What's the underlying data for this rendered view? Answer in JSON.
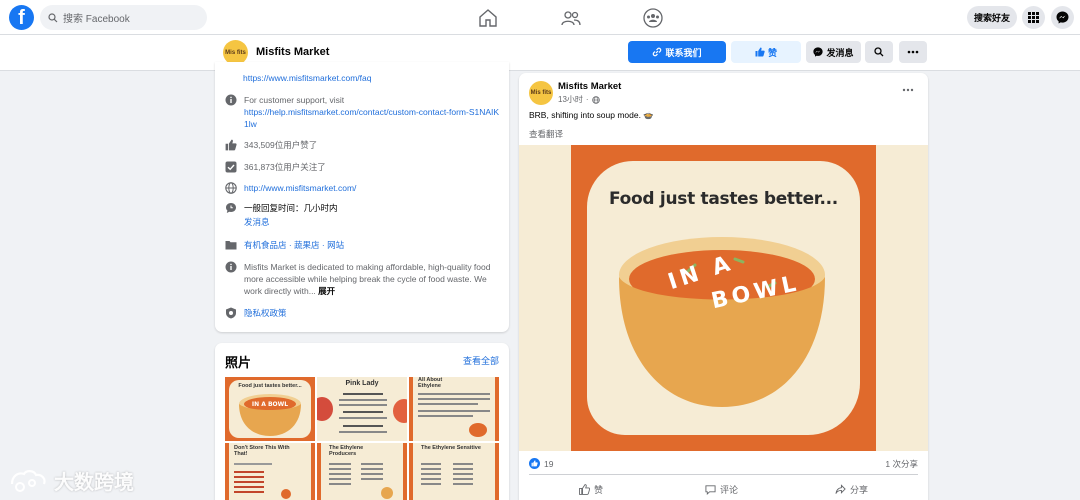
{
  "topnav": {
    "logo_letter": "f",
    "search_placeholder": "搜索 Facebook",
    "find_friends_label": "搜索好友"
  },
  "page_header": {
    "avatar_text": "Mis fits",
    "name": "Misfits Market",
    "contact_button": "联系我们",
    "like_button": "赞",
    "message_button": "发消息"
  },
  "about": {
    "faq_link": "https://www.misfitsmarket.com/faq",
    "support_text": "For customer support, visit",
    "support_link": "https://help.misfitsmarket.com/contact/custom-contact-form-S1NAIK1lw",
    "likes_text": "343,509位用户赞了",
    "follows_text": "361,873位用户关注了",
    "website": "http://www.misfitsmarket.com/",
    "response_time": "一般回复时间：几小时内",
    "send_message": "发消息",
    "categories": "有机食品店 · 蔬果店 · 网站",
    "description": "Misfits Market is dedicated to making affordable, high-quality food more accessible while helping break the cycle of food waste. We work directly with...",
    "expand": "展开",
    "privacy": "隐私权政策"
  },
  "photos": {
    "title": "照片",
    "see_all": "查看全部",
    "tiles": [
      {
        "title": "Food just tastes better..."
      },
      {
        "title": "Pink Lady"
      },
      {
        "title": "All About Ethylene"
      },
      {
        "title": "Don't Store This With That!"
      },
      {
        "title": "The Ethylene Producers"
      },
      {
        "title": "The Ethylene Sensitive"
      }
    ]
  },
  "post": {
    "avatar_text": "Mis fits",
    "author": "Misfits Market",
    "time": "13小时",
    "text": "BRB, shifting into soup mode. 🍲",
    "translate": "查看翻译",
    "image_headline": "Food just tastes better...",
    "bowl_text_1": "IN A",
    "bowl_text_2": "BOWL",
    "reaction_count": "19",
    "share_count": "1 次分享",
    "like_label": "赞",
    "comment_label": "评论",
    "share_label": "分享"
  },
  "watermark": {
    "text": "大数跨境"
  },
  "colors": {
    "facebook_blue": "#1877f2",
    "page_bg": "#f0f2f5",
    "soup_orange": "#e06a2c",
    "cream": "#f6ecd5",
    "bowl": "#e7a64f"
  }
}
